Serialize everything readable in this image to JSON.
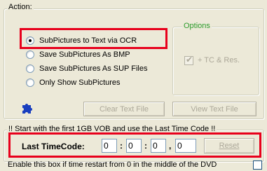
{
  "action_group": {
    "title": "Action:",
    "options": [
      {
        "label": "SubPictures to Text via OCR",
        "checked": true
      },
      {
        "label": "Save SubPictures As BMP",
        "checked": false
      },
      {
        "label": "Save SubPictures As SUP Files",
        "checked": false
      },
      {
        "label": "Only Show SubPictures",
        "checked": false
      }
    ],
    "puzzle_icon": "puzzle-icon",
    "clear_button": "Clear Text File",
    "view_button": "View Text File"
  },
  "options_group": {
    "title": "Options",
    "tc_res_label": "+ TC & Res.",
    "tc_res_checked": true
  },
  "timecode_group": {
    "title": "!! Start with the first 1GB VOB and use the Last Time Code !!",
    "label": "Last TimeCode:",
    "hours": "0",
    "minutes": "0",
    "seconds": "0",
    "frames": "0",
    "sep1": ":",
    "sep2": ":",
    "sep3": ",",
    "reset_button": "Reset"
  },
  "restart_checkbox_label": "Enable this box if time restart from 0 in the middle of the DVD",
  "colors": {
    "highlight": "#e8001c",
    "options_title": "#2b9b2b",
    "puzzle": "#1a3fbf"
  }
}
